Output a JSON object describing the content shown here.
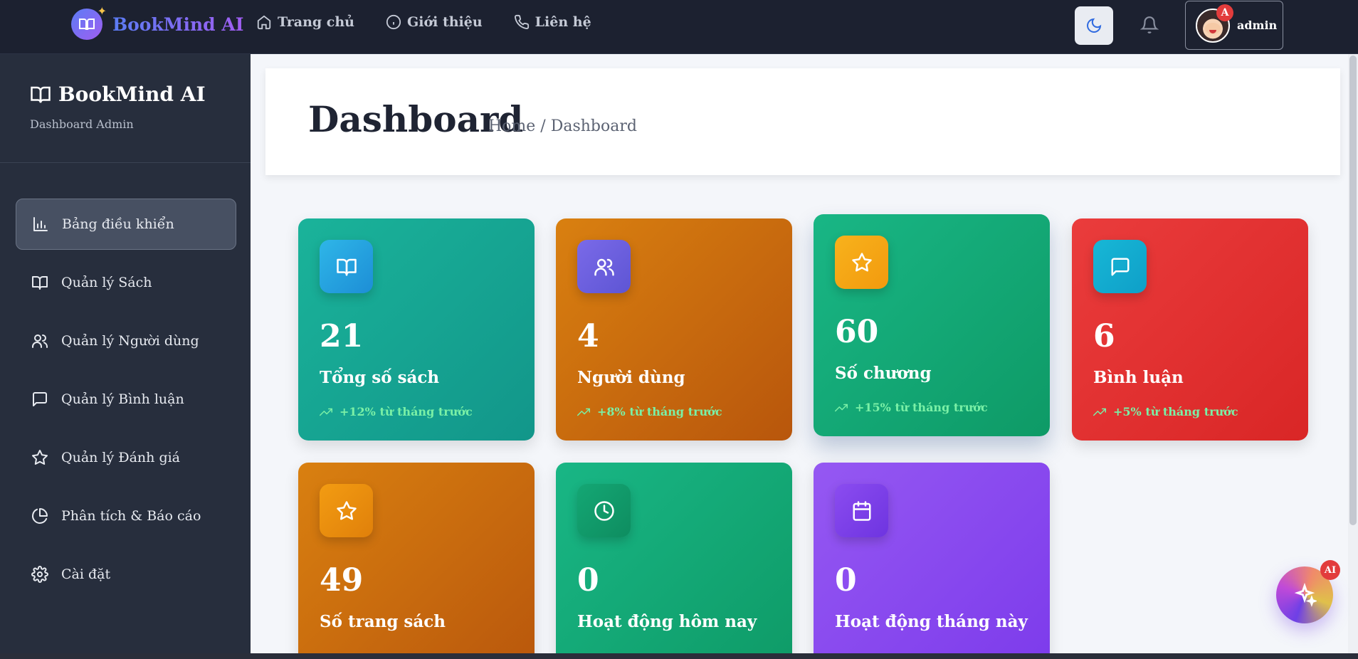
{
  "topbar": {
    "brand": "BookMind AI",
    "nav": [
      {
        "label": "Trang chủ",
        "icon": "home-icon"
      },
      {
        "label": "Giới thiệu",
        "icon": "info-icon"
      },
      {
        "label": "Liên hệ",
        "icon": "phone-icon"
      }
    ],
    "user": {
      "name": "admin",
      "badge": "A"
    }
  },
  "sidebar": {
    "title": "BookMind AI",
    "subtitle": "Dashboard Admin",
    "items": [
      {
        "label": "Bảng điều khiển",
        "icon": "bar-chart-icon",
        "active": true
      },
      {
        "label": "Quản lý Sách",
        "icon": "book-icon"
      },
      {
        "label": "Quản lý Người dùng",
        "icon": "users-icon"
      },
      {
        "label": "Quản lý Bình luận",
        "icon": "comment-icon"
      },
      {
        "label": "Quản lý Đánh giá",
        "icon": "star-icon"
      },
      {
        "label": "Phân tích & Báo cáo",
        "icon": "pie-chart-icon"
      },
      {
        "label": "Cài đặt",
        "icon": "gear-icon"
      }
    ]
  },
  "header": {
    "title": "Dashboard",
    "breadcrumb": "Home / Dashboard"
  },
  "stats": [
    {
      "value": "21",
      "label": "Tổng số sách",
      "trend": "+12% từ tháng trước",
      "icon": "book-icon",
      "color": "#1ab39a"
    },
    {
      "value": "4",
      "label": "Người dùng",
      "trend": "+8% từ tháng trước",
      "icon": "users-icon",
      "color": "#d98010"
    },
    {
      "value": "60",
      "label": "Số chương",
      "trend": "+15% từ tháng trước",
      "icon": "star-icon",
      "color": "#19b685"
    },
    {
      "value": "6",
      "label": "Bình luận",
      "trend": "+5% từ tháng trước",
      "icon": "comment-icon",
      "color": "#ea3c3c"
    },
    {
      "value": "49",
      "label": "Số trang sách",
      "trend": "",
      "icon": "star-icon",
      "color": "#d98010"
    },
    {
      "value": "0",
      "label": "Hoạt động hôm nay",
      "trend": "",
      "icon": "clock-icon",
      "color": "#19b685"
    },
    {
      "value": "0",
      "label": "Hoạt động tháng này",
      "trend": "",
      "icon": "calendar-icon",
      "color": "#9558f2"
    }
  ],
  "ai_button": {
    "badge": "AI"
  }
}
